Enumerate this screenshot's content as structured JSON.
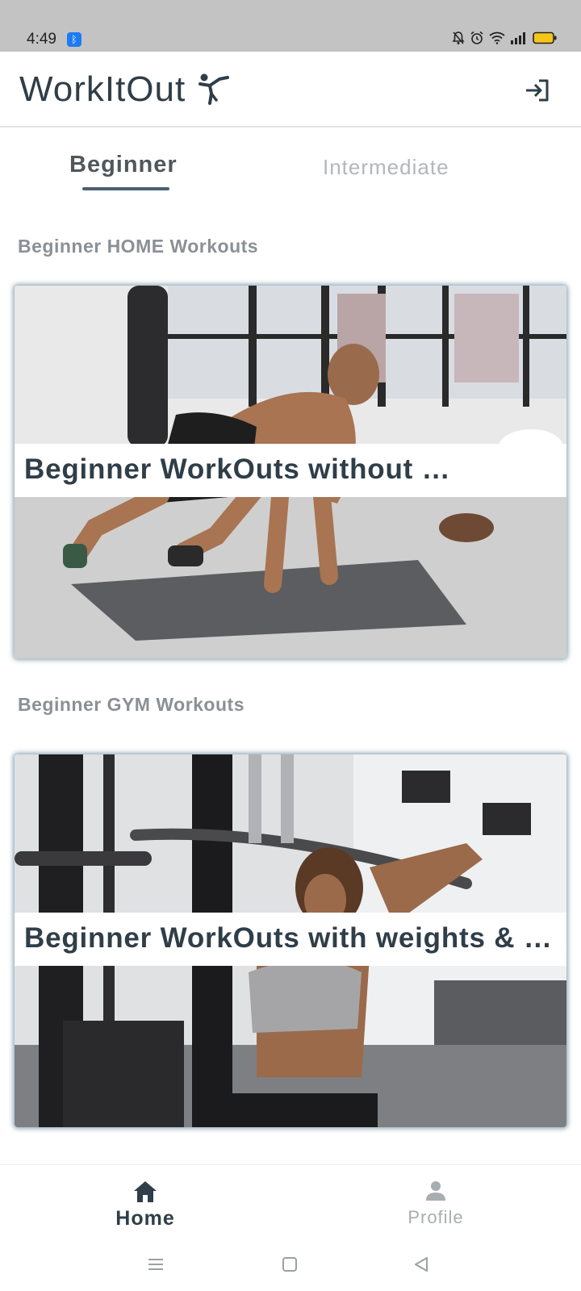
{
  "status_bar": {
    "time": "4:49",
    "bt_symbol": "ᛒ"
  },
  "app_bar": {
    "title": "WorkItOut",
    "title_icon": "martial-arts-kick-icon",
    "action_icon": "logout-icon"
  },
  "tabs": [
    {
      "label": "Beginner",
      "selected": true
    },
    {
      "label": "Intermediate",
      "selected": false
    }
  ],
  "sections": [
    {
      "title": "Beginner HOME Workouts",
      "card_caption": "Beginner WorkOuts without …"
    },
    {
      "title": "Beginner GYM Workouts",
      "card_caption": "Beginner WorkOuts with weights & …"
    }
  ],
  "bottom_nav": {
    "items": [
      {
        "label": "Home",
        "icon": "home-icon",
        "selected": true
      },
      {
        "label": "Profile",
        "icon": "person-icon",
        "selected": false
      }
    ]
  },
  "colors": {
    "primary_text": "#2f3e48",
    "accent": "#4b6170",
    "muted": "#8a9096",
    "status_bar": "#c3c3c3"
  }
}
